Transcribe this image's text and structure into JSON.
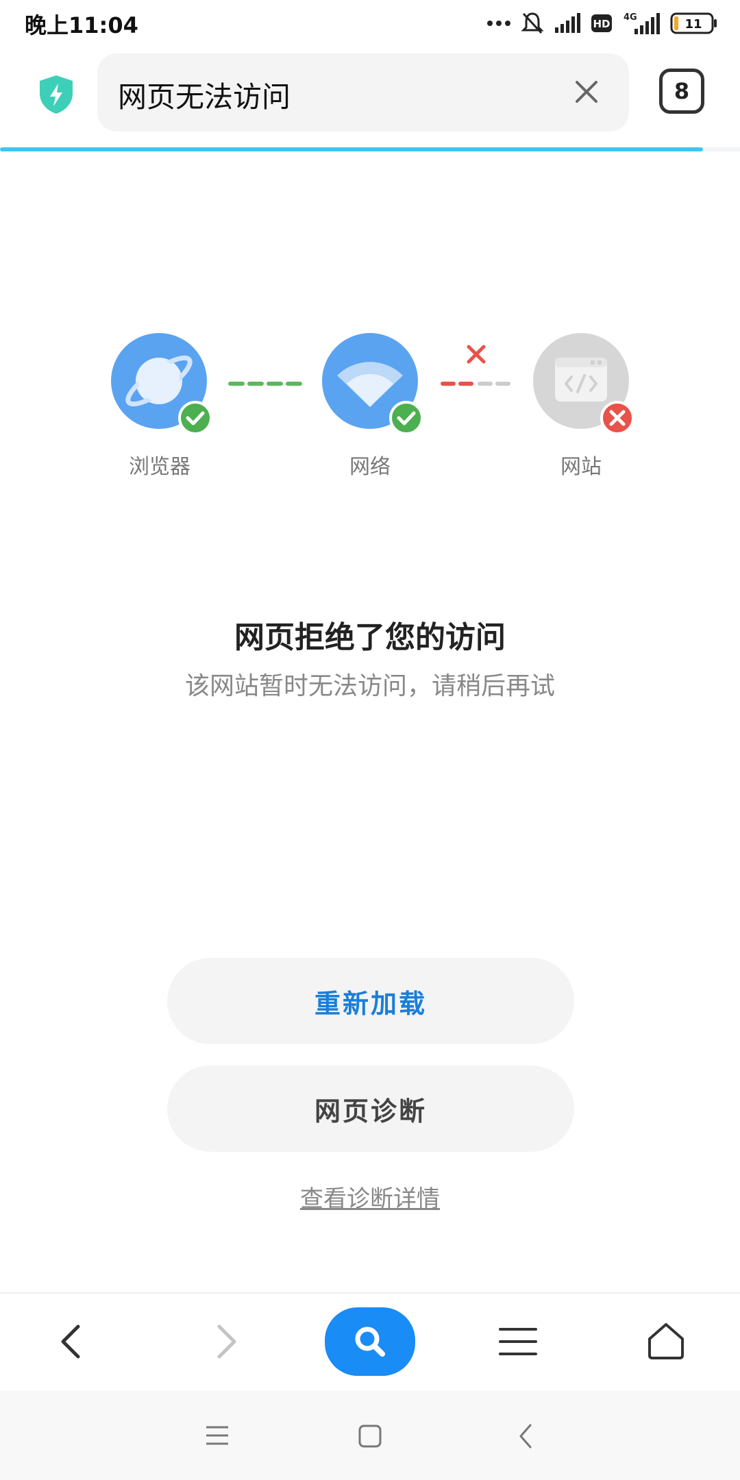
{
  "status_bar": {
    "time": "晚上11:04",
    "network": "4G",
    "hd_badge": "HD",
    "battery_level": "11"
  },
  "address_bar": {
    "page_title": "网页无法访问",
    "tab_count": "8",
    "load_progress_percent": 95,
    "accent_color": "#3ec6f0"
  },
  "diagnosis": {
    "nodes": [
      {
        "label": "浏览器",
        "status": "ok",
        "icon": "planet-icon"
      },
      {
        "label": "网络",
        "status": "ok",
        "icon": "wifi-icon"
      },
      {
        "label": "网站",
        "status": "error",
        "icon": "code-window-icon"
      }
    ],
    "ok_color": "#4caf50",
    "error_color": "#e8524a",
    "title": "网页拒绝了您的访问",
    "message": "该网站暂时无法访问，请稍后再试"
  },
  "actions": {
    "reload_label": "重新加载",
    "diagnose_label": "网页诊断",
    "details_link": "查看诊断详情"
  },
  "toolbar": {
    "items": [
      "back-icon",
      "forward-icon",
      "search-icon",
      "menu-icon",
      "home-icon"
    ]
  },
  "system_nav": {
    "items": [
      "recents-icon",
      "home-square-icon",
      "system-back-icon"
    ]
  }
}
